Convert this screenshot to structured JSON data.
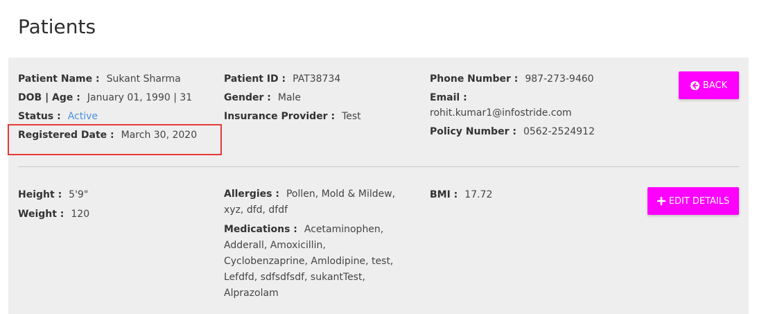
{
  "page": {
    "title": "Patients"
  },
  "patient": {
    "name_label": "Patient Name :",
    "name": "Sukant Sharma",
    "dob_label": "DOB | Age :",
    "dob": "January 01, 1990 | 31",
    "status_label": "Status :",
    "status": "Active",
    "registered_label": "Registered Date :",
    "registered": "March 30, 2020",
    "id_label": "Patient ID :",
    "id": "PAT38734",
    "gender_label": "Gender :",
    "gender": "Male",
    "insurance_label": "Insurance Provider :",
    "insurance": "Test",
    "phone_label": "Phone Number :",
    "phone": "987-273-9460",
    "email_label": "Email :",
    "email": "rohit.kumar1@infostride.com",
    "policy_label": "Policy Number :",
    "policy": "0562-2524912"
  },
  "vitals": {
    "height_label": "Height :",
    "height": "5'9\"",
    "weight_label": "Weight :",
    "weight": "120",
    "allergies_label": "Allergies :",
    "allergies_line1": "Pollen, Mold & Mildew,",
    "allergies_line2": "xyz, dfd, dfdf",
    "medications_label": "Medications :",
    "medications_line1": "Acetaminophen,",
    "medications_line2": "Adderall, Amoxicillin,",
    "medications_line3": "Cyclobenzaprine, Amlodipine, test,",
    "medications_line4": "Lefdfd, sdfsdfsdf, sukantTest,",
    "medications_line5": "Alprazolam",
    "bmi_label": "BMI :",
    "bmi": "17.72"
  },
  "buttons": {
    "back": "BACK",
    "back_icon": "arrow-left-circle",
    "edit": "EDIT DETAILS",
    "edit_icon": "plus",
    "color": "#ff00ff"
  },
  "highlight_color": "#e53935"
}
